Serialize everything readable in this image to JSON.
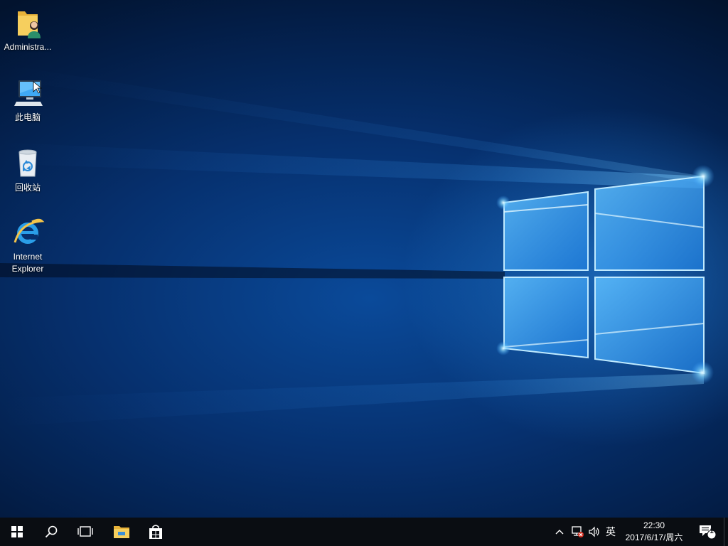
{
  "desktop": {
    "icons": [
      {
        "label": "Administra...",
        "icon": "user-folder-icon"
      },
      {
        "label": "此电脑",
        "icon": "this-pc-icon"
      },
      {
        "label": "回收站",
        "icon": "recycle-bin-icon"
      },
      {
        "label": "Internet Explorer",
        "icon": "internet-explorer-icon"
      }
    ]
  },
  "taskbar": {
    "start": {
      "icon": "windows-logo-icon"
    },
    "search": {
      "icon": "search-icon"
    },
    "task_view": {
      "icon": "task-view-icon"
    },
    "pinned": [
      {
        "icon": "file-explorer-icon"
      },
      {
        "icon": "store-icon"
      }
    ],
    "tray": {
      "chevron_icon": "chevron-up-icon",
      "network_icon": "network-disconnected-icon",
      "volume_icon": "volume-icon",
      "ime_label": "英"
    },
    "clock": {
      "time": "22:30",
      "date": "2017/6/17/周六"
    },
    "notifications": {
      "icon": "action-center-icon",
      "count": "1"
    }
  },
  "colors": {
    "taskbar_bg": "#0a0d12",
    "wallpaper_dark": "#02132e",
    "wallpaper_glow": "#4ab8ff",
    "folder_yellow": "#f3c44a",
    "store_accent": "#ffffff"
  }
}
